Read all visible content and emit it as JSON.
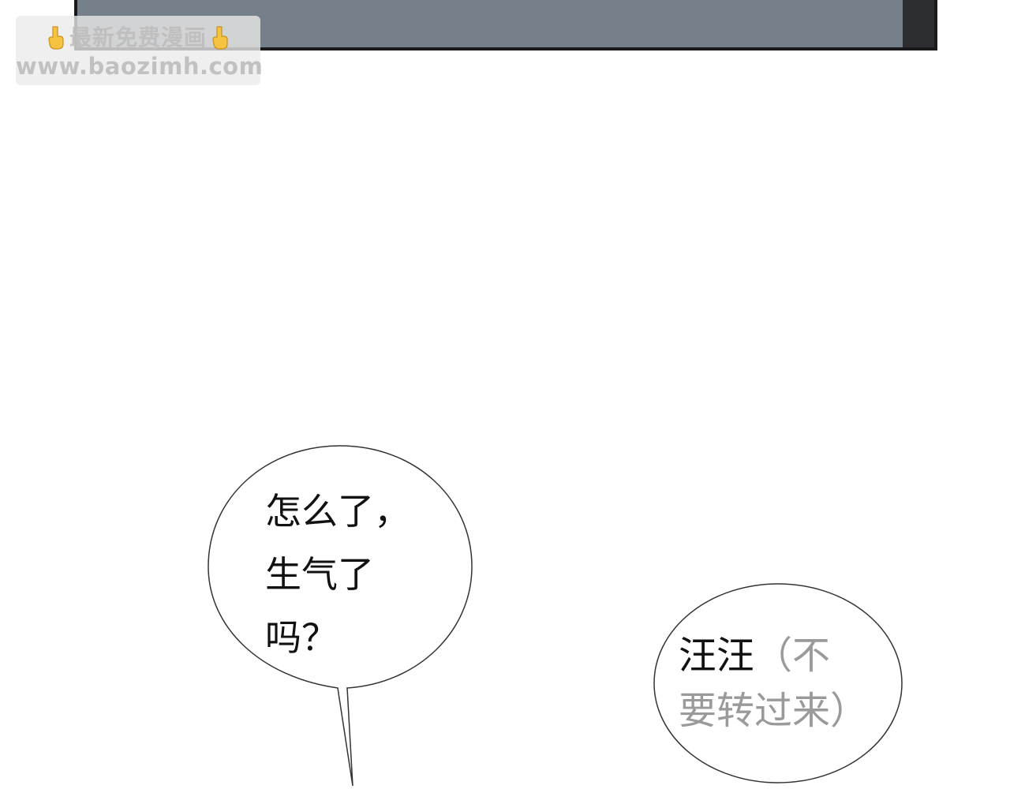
{
  "watermark": {
    "title": "最新免费漫画",
    "url": "www.baozimh.com",
    "icon_left": "pointing-down-hand-icon",
    "icon_right": "pointing-down-hand-icon"
  },
  "bubble_left": {
    "lines": [
      "怎么了，",
      "生气了",
      "吗？"
    ]
  },
  "bubble_right": {
    "speech": "汪汪",
    "aside_line1": "（不",
    "aside_line2": "要转过来）"
  },
  "colors": {
    "panel_gray": "#76808a",
    "panel_border": "#1a1a1a",
    "aside_text": "#9a9a9a"
  }
}
